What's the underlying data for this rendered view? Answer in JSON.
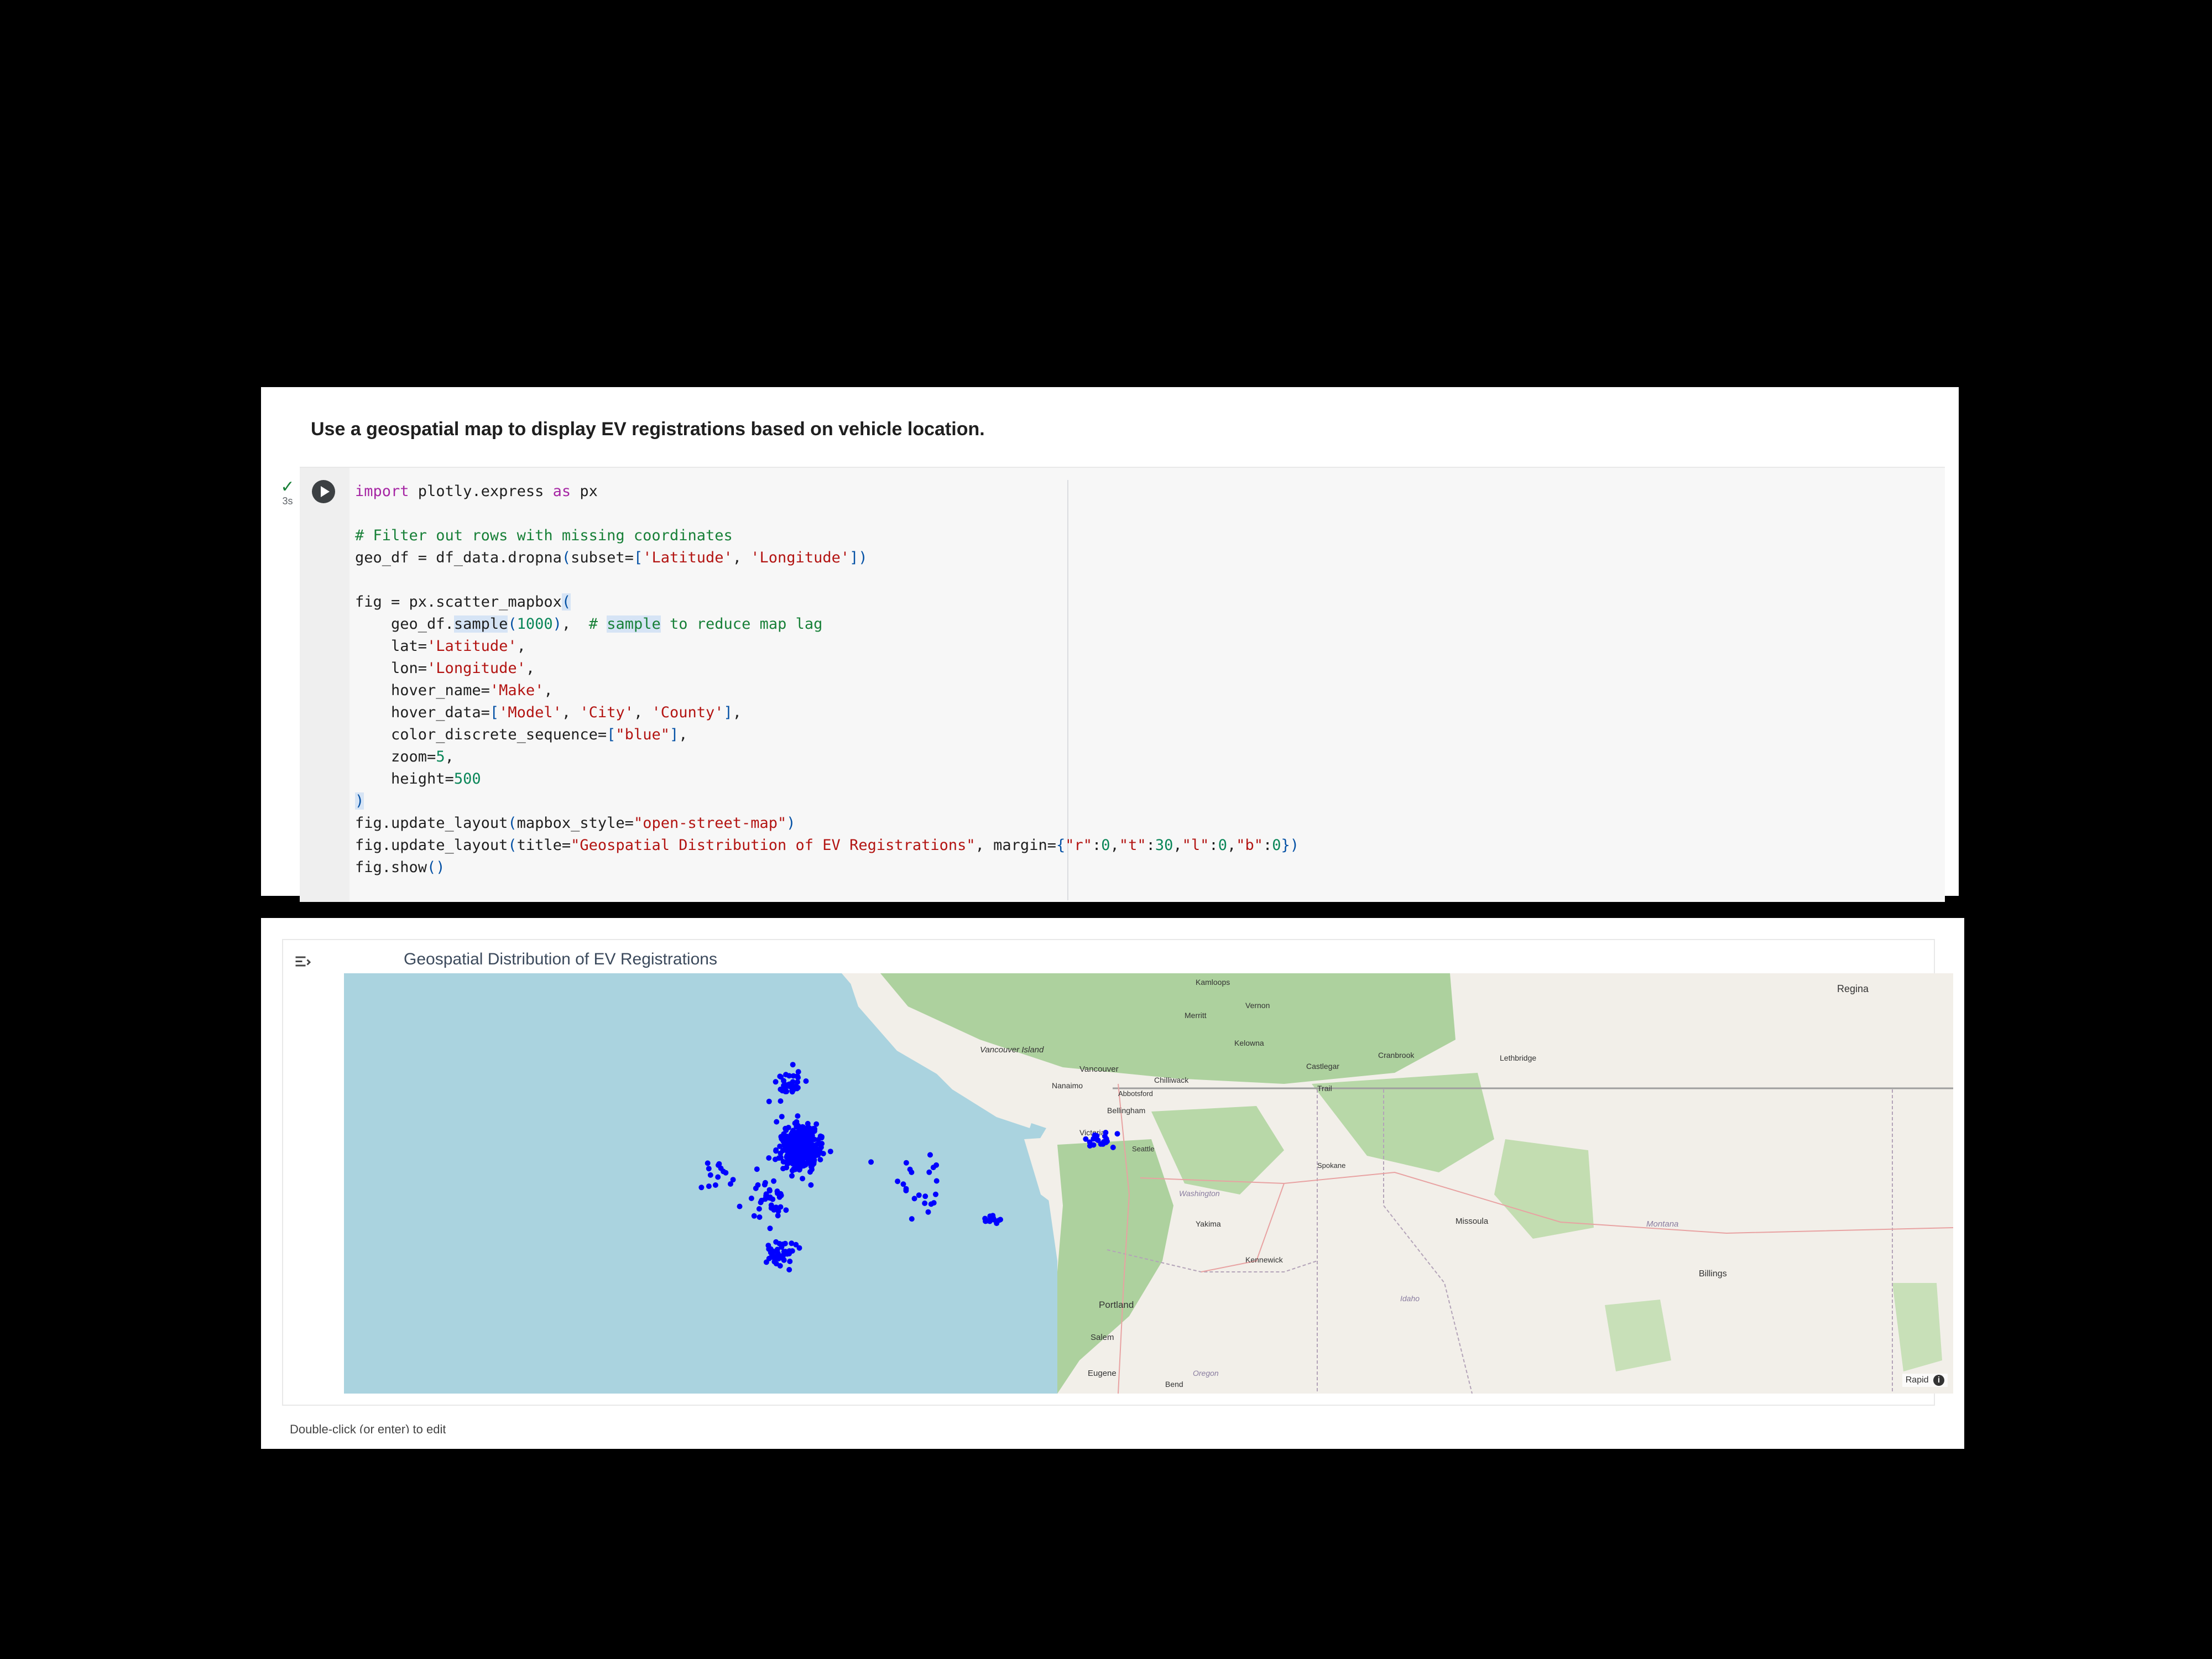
{
  "markdown_cell": {
    "text": "Use a geospatial map to display EV registrations based on vehicle location."
  },
  "code_cell": {
    "status_check": "✓",
    "duration": "3s",
    "lines": [
      "import plotly.express as px",
      "",
      "# Filter out rows with missing coordinates",
      "geo_df = df_data.dropna(subset=['Latitude', 'Longitude'])",
      "",
      "fig = px.scatter_mapbox(",
      "    geo_df.sample(1000),  # sample to reduce map lag",
      "    lat='Latitude',",
      "    lon='Longitude',",
      "    hover_name='Make',",
      "    hover_data=['Model', 'City', 'County'],",
      "    color_discrete_sequence=[\"blue\"],",
      "    zoom=5,",
      "    height=500",
      ")",
      "fig.update_layout(mapbox_style=\"open-street-map\")",
      "fig.update_layout(title=\"Geospatial Distribution of EV Registrations\", margin={\"r\":0,\"t\":30,\"l\":0,\"b\":0})",
      "fig.show()"
    ]
  },
  "output_cell": {
    "title": "Geospatial Distribution of EV Registrations",
    "attribution": "Rapid",
    "info_icon": "i",
    "footer_hint": "Double-click (or enter) to edit"
  },
  "map_labels": {
    "kamloops": "Kamloops",
    "vernon": "Vernon",
    "merritt": "Merritt",
    "kelowna": "Kelowna",
    "vancouver_island": "Vancouver Island",
    "vancouver": "Vancouver",
    "chilliwack": "Chilliwack",
    "castlegar": "Castlegar",
    "cranbrook": "Cranbrook",
    "lethbridge": "Lethbridge",
    "regina": "Regina",
    "nanaimo": "Nanaimo",
    "trail": "Trail",
    "abbotsford": "Abbotsford",
    "bellingham": "Bellingham",
    "victoria": "Victoria",
    "seattle": "Seattle",
    "spokane": "Spokane",
    "washington": "Washington",
    "missoula": "Missoula",
    "montana": "Montana",
    "yakima": "Yakima",
    "kennewick": "Kennewick",
    "billings": "Billings",
    "idaho": "Idaho",
    "portland": "Portland",
    "salem": "Salem",
    "eugene": "Eugene",
    "oregon": "Oregon",
    "bend": "Bend"
  },
  "colors": {
    "water": "#aad3df",
    "land": "#f2efe9",
    "forest": "#add19e",
    "points": "#0000ff",
    "border": "#9e9e9e"
  },
  "chart_data": {
    "type": "scatter",
    "title": "Geospatial Distribution of EV Registrations",
    "map_style": "open-street-map",
    "zoom": 5,
    "marker_color": "blue",
    "lat_range": [
      42.9,
      50.9
    ],
    "lon_range": [
      -129.7,
      -103.6
    ],
    "clusters": [
      {
        "lat": 47.6,
        "lon": -122.3,
        "n": 420,
        "spread": [
          0.35,
          0.25
        ]
      },
      {
        "lat": 48.8,
        "lon": -122.5,
        "n": 35,
        "spread": [
          0.25,
          0.2
        ]
      },
      {
        "lat": 45.6,
        "lon": -122.6,
        "n": 45,
        "spread": [
          0.2,
          0.2
        ]
      },
      {
        "lat": 46.6,
        "lon": -122.8,
        "n": 40,
        "spread": [
          0.4,
          0.2
        ]
      },
      {
        "lat": 47.0,
        "lon": -123.7,
        "n": 14,
        "spread": [
          0.35,
          0.3
        ]
      },
      {
        "lat": 47.7,
        "lon": -117.4,
        "n": 20,
        "spread": [
          0.12,
          0.2
        ]
      },
      {
        "lat": 46.2,
        "lon": -119.2,
        "n": 12,
        "spread": [
          0.1,
          0.15
        ]
      },
      {
        "lat": 46.6,
        "lon": -120.5,
        "n": 12,
        "spread": [
          0.3,
          0.4
        ]
      },
      {
        "lat": 47.2,
        "lon": -120.5,
        "n": 10,
        "spread": [
          0.25,
          0.6
        ]
      }
    ]
  }
}
